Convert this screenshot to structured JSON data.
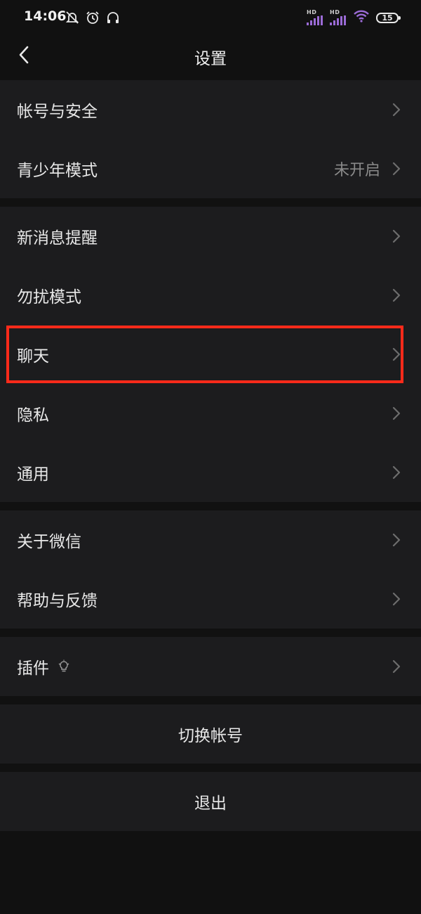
{
  "status_bar": {
    "time": "14:06",
    "sim1_label": "HD",
    "sim2_label": "HD",
    "battery_level": "15",
    "icons": [
      "mute-icon",
      "alarm-icon",
      "headphones-icon",
      "signal-icon",
      "signal-icon",
      "wifi-icon",
      "battery-icon"
    ]
  },
  "navbar": {
    "back_icon": "chevron-left-icon",
    "title": "设置"
  },
  "groups": [
    {
      "items": [
        {
          "label": "帐号与安全",
          "value": ""
        },
        {
          "label": "青少年模式",
          "value": "未开启"
        }
      ]
    },
    {
      "items": [
        {
          "label": "新消息提醒",
          "value": ""
        },
        {
          "label": "勿扰模式",
          "value": ""
        },
        {
          "label": "聊天",
          "value": "",
          "highlighted": true
        },
        {
          "label": "隐私",
          "value": ""
        },
        {
          "label": "通用",
          "value": ""
        }
      ]
    },
    {
      "items": [
        {
          "label": "关于微信",
          "value": ""
        },
        {
          "label": "帮助与反馈",
          "value": ""
        }
      ]
    },
    {
      "items": [
        {
          "label": "插件",
          "value": "",
          "icon": "lightbulb-icon"
        }
      ]
    }
  ],
  "buttons": {
    "switch_account": "切换帐号",
    "logout": "退出"
  },
  "colors": {
    "background": "#111111",
    "cell_background": "#1c1c1e",
    "text": "#e8e8e8",
    "secondary_text": "#8a8a8a",
    "highlight_border": "#ff2a1a",
    "signal_accent": "#9b6bd6"
  }
}
